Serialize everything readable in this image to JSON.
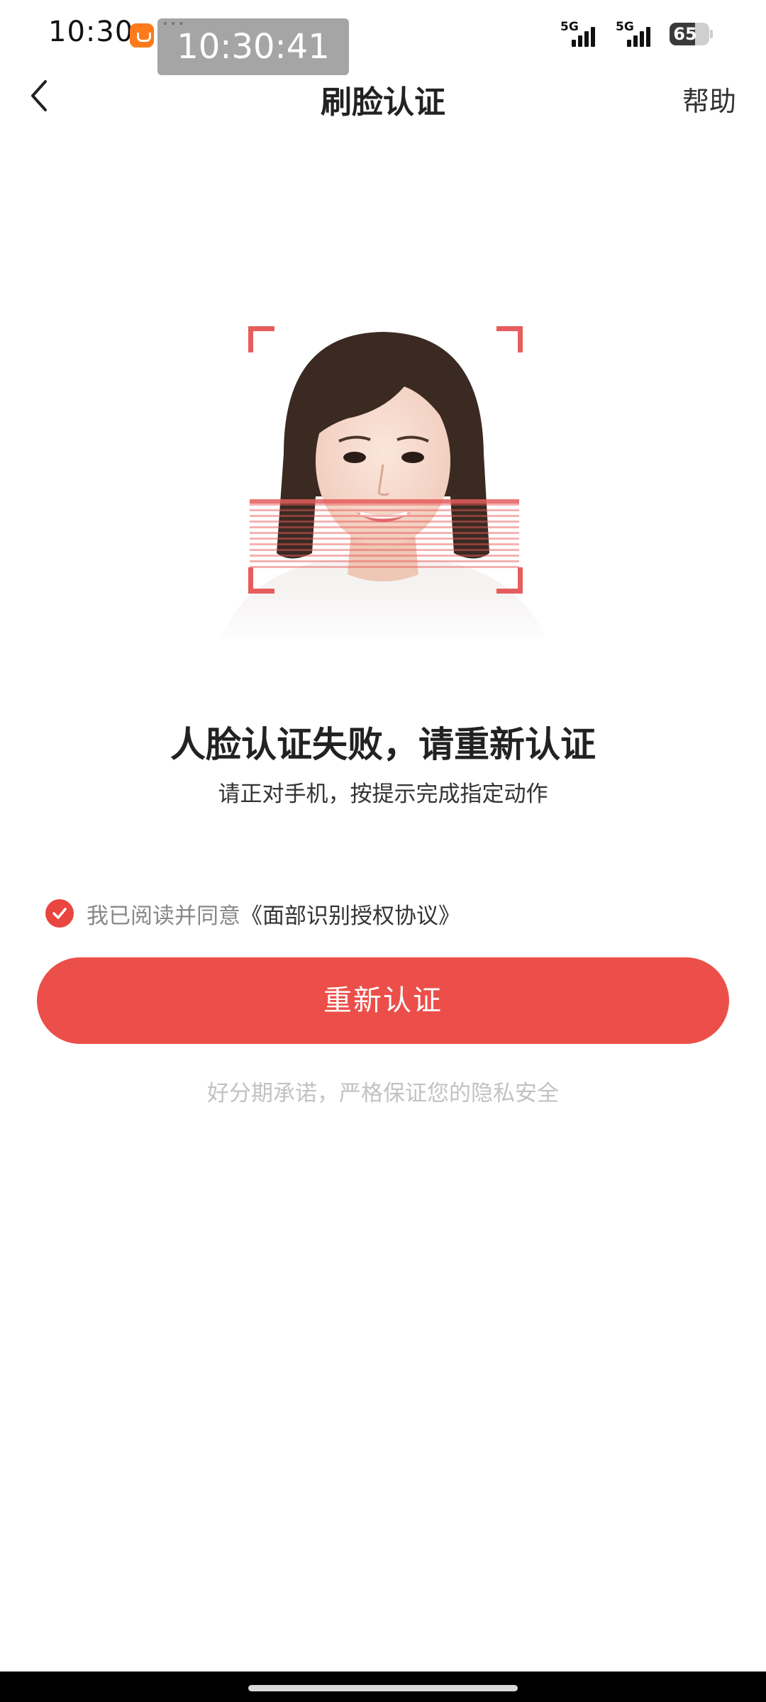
{
  "status_bar": {
    "time": "10:30",
    "dots": "···",
    "timer_overlay": "10:30:41",
    "network_1": "5G",
    "network_2": "5G",
    "battery_level": "65",
    "battery_fraction": 0.65
  },
  "nav": {
    "title": "刷脸认证",
    "help_label": "帮助"
  },
  "colors": {
    "accent": "#ec4f49",
    "scan_frame": "#e55d5d"
  },
  "face_illustration": {
    "icon": "face-scan-illustration"
  },
  "message": {
    "title": "人脸认证失败，请重新认证",
    "subtitle": "请正对手机，按提示完成指定动作"
  },
  "agreement": {
    "checked": true,
    "text": "我已阅读并同意",
    "link_text": "《面部识别授权协议》"
  },
  "primary_button": {
    "label": "重新认证"
  },
  "footer": {
    "privacy_note": "好分期承诺，严格保证您的隐私安全"
  }
}
